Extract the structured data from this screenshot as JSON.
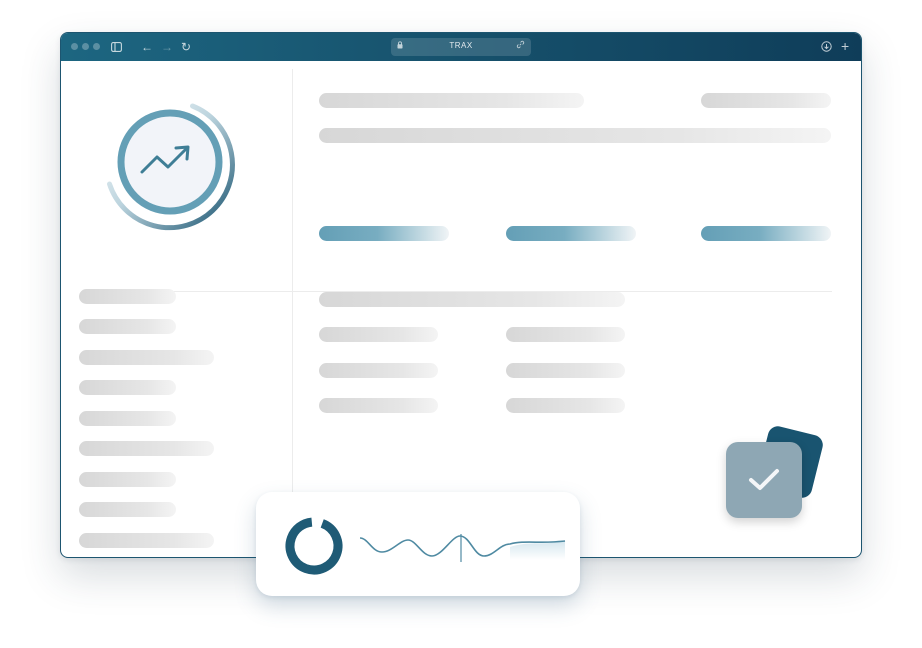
{
  "browser": {
    "address_text": "TRAX",
    "icons": {
      "lock": "lock-icon",
      "link": "link-icon",
      "sidebar": "sidebar-toggle-icon",
      "back": "back-arrow-icon",
      "forward": "forward-arrow-icon",
      "reload": "reload-icon",
      "download": "download-icon",
      "new_tab": "plus-icon"
    }
  },
  "colors": {
    "accent": "#649fb6",
    "brand_dark": "#195470",
    "placeholder": "#d7d7d7",
    "check_card": "#8ea7b4"
  },
  "glyphs": {
    "back": "←",
    "forward": "→",
    "reload": "↻",
    "plus": "+",
    "sidebar": "▣"
  }
}
